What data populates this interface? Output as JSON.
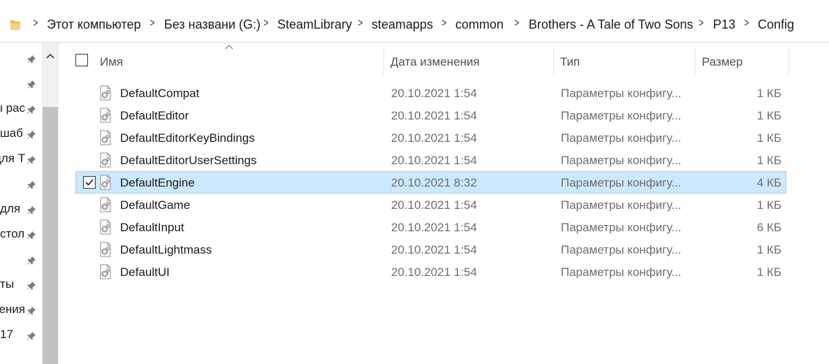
{
  "address_bar": {
    "crumbs": [
      "Этот компьютер",
      "Без названи (G:)",
      "SteamLibrary",
      "steamapps",
      "common",
      "Brothers - A Tale of Two Sons",
      "P13",
      "Config"
    ]
  },
  "nav": {
    "labels": [
      "",
      "",
      "ы рас",
      "шаб",
      "для Т",
      "",
      "для",
      "стол",
      "",
      "ты",
      "жения",
      "17"
    ]
  },
  "columns": {
    "name": "Имя",
    "date": "Дата изменения",
    "type": "Тип",
    "size": "Размер"
  },
  "files": [
    {
      "name": "DefaultCompat",
      "date": "20.10.2021 1:54",
      "type": "Параметры конфигу...",
      "size": "1 КБ",
      "selected": false
    },
    {
      "name": "DefaultEditor",
      "date": "20.10.2021 1:54",
      "type": "Параметры конфигу...",
      "size": "1 КБ",
      "selected": false
    },
    {
      "name": "DefaultEditorKeyBindings",
      "date": "20.10.2021 1:54",
      "type": "Параметры конфигу...",
      "size": "1 КБ",
      "selected": false
    },
    {
      "name": "DefaultEditorUserSettings",
      "date": "20.10.2021 1:54",
      "type": "Параметры конфигу...",
      "size": "1 КБ",
      "selected": false
    },
    {
      "name": "DefaultEngine",
      "date": "20.10.2021 8:32",
      "type": "Параметры конфигу...",
      "size": "4 КБ",
      "selected": true
    },
    {
      "name": "DefaultGame",
      "date": "20.10.2021 1:54",
      "type": "Параметры конфигу...",
      "size": "1 КБ",
      "selected": false
    },
    {
      "name": "DefaultInput",
      "date": "20.10.2021 1:54",
      "type": "Параметры конфигу...",
      "size": "6 КБ",
      "selected": false
    },
    {
      "name": "DefaultLightmass",
      "date": "20.10.2021 1:54",
      "type": "Параметры конфигу...",
      "size": "1 КБ",
      "selected": false
    },
    {
      "name": "DefaultUI",
      "date": "20.10.2021 1:54",
      "type": "Параметры конфигу...",
      "size": "1 КБ",
      "selected": false
    }
  ],
  "icons": {
    "folder": "folder-icon",
    "pin": "pin-icon",
    "file": "config-file-icon",
    "checkbox": "checkbox-icon",
    "sort": "sort-ascending-icon",
    "breadcrumb_separator": "chevron-right-icon",
    "scroll_up": "scroll-up-icon"
  },
  "colors": {
    "selection_bg": "#cce8ff",
    "selection_border": "#99d1ff",
    "header_text": "#505050",
    "secondary_text": "#6d6d6d"
  }
}
